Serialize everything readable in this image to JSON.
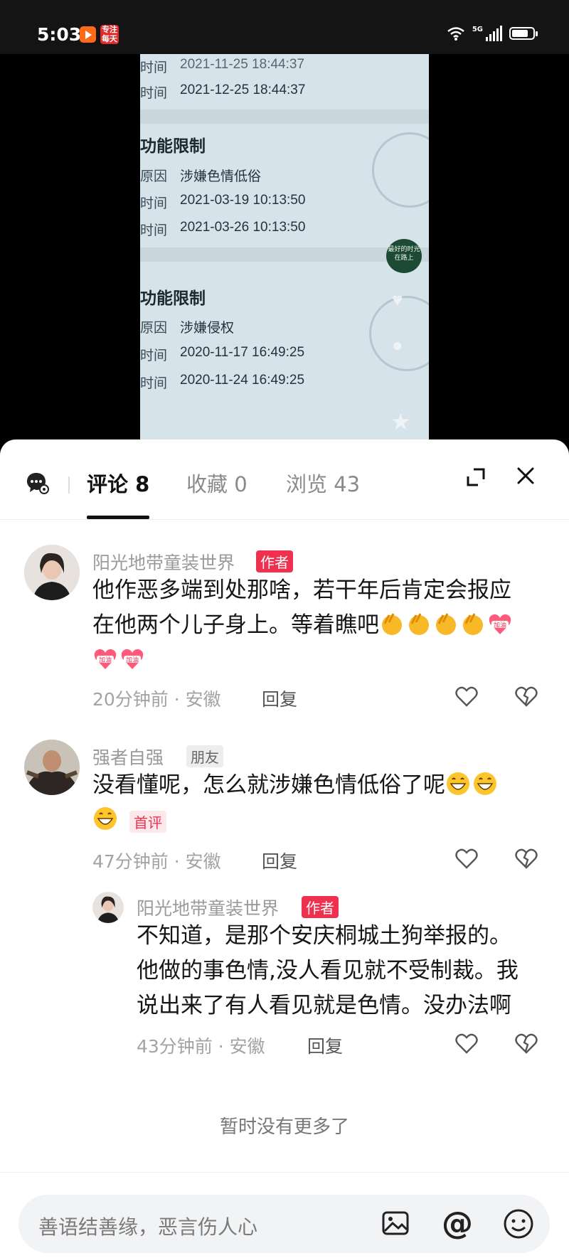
{
  "status_bar": {
    "time": "5:03",
    "network": "5G",
    "app_badge": "专注\n每天"
  },
  "video": {
    "top_row": {
      "key": "时间",
      "value": "2021-12-25 18:44:37"
    },
    "sections": [
      {
        "heading": "功能限制",
        "reason_key": "原因",
        "reason": "涉嫌色情低俗",
        "rows": [
          {
            "key": "时间",
            "value": "2021-03-19 10:13:50"
          },
          {
            "key": "时间",
            "value": "2021-03-26 10:13:50"
          }
        ]
      },
      {
        "heading": "功能限制",
        "reason_key": "原因",
        "reason": "涉嫌侵权",
        "rows": [
          {
            "key": "时间",
            "value": "2020-11-17 16:49:25"
          },
          {
            "key": "时间",
            "value": "2020-11-24 16:49:25"
          }
        ]
      }
    ],
    "badge_text": "最好的时光\n在路上"
  },
  "tabs": [
    {
      "label": "评论 8",
      "active": true
    },
    {
      "label": "收藏 0",
      "active": false
    },
    {
      "label": "浏览 43",
      "active": false
    }
  ],
  "comments": [
    {
      "username": "阳光地带童装世界",
      "tag": "作者",
      "text_line1": "他作恶多端到处那啥，若干年后肯定会报应",
      "text_line2": "在他两个儿子身上。等着瞧吧",
      "time": "20分钟前",
      "location": "安徽",
      "reply_label": "回复"
    },
    {
      "username": "强者自强",
      "tag": "朋友",
      "tag2": "首评",
      "text_line1": "没看懂呢，怎么就涉嫌色情低俗了呢",
      "time": "47分钟前",
      "location": "安徽",
      "reply_label": "回复"
    },
    {
      "username": "阳光地带童装世界",
      "tag": "作者",
      "text_line1": "不知道，是那个安庆桐城土狗举报的。",
      "text_line2": "他做的事色情,没人看见就不受制裁。我",
      "text_line3": "说出来了有人看见就是色情。没办法啊",
      "time": "43分钟前",
      "location": "安徽",
      "reply_label": "回复"
    }
  ],
  "meta_sep": "·",
  "emoji_label": "加油",
  "no_more": "暂时没有更多了",
  "input": {
    "placeholder": "善语结善缘，恶言伤人心"
  },
  "colors": {
    "author_tag": "#f0304f",
    "sheet_bg": "#ffffff",
    "video_screen": "#d7e3ea"
  }
}
